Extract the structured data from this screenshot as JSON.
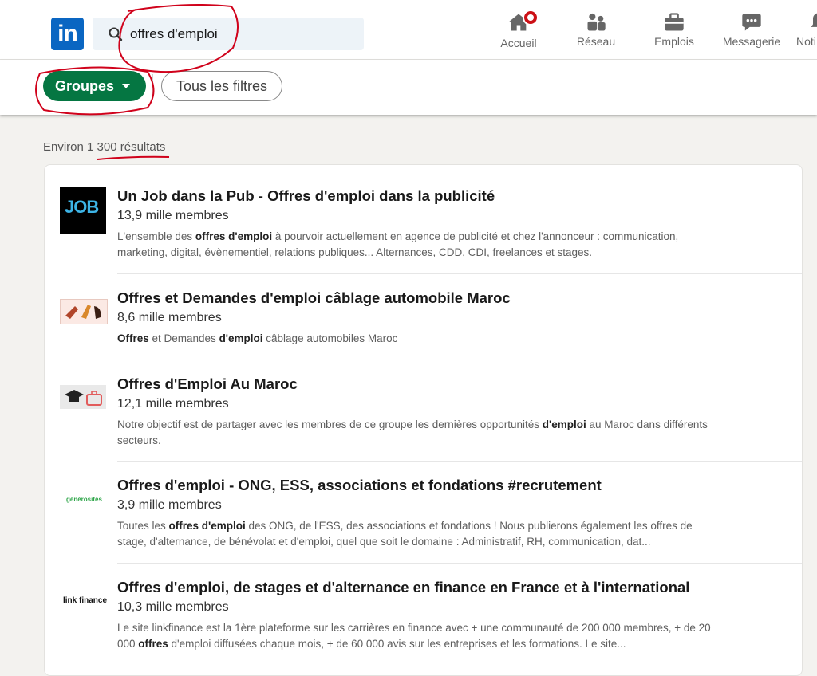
{
  "nav": {
    "logo_text": "in",
    "search_value": "offres d'emploi",
    "items": [
      {
        "label": "Accueil",
        "icon": "home-icon"
      },
      {
        "label": "Réseau",
        "icon": "network-icon"
      },
      {
        "label": "Emplois",
        "icon": "briefcase-icon"
      },
      {
        "label": "Messagerie",
        "icon": "messaging-icon"
      },
      {
        "label": "Noti",
        "icon": "bell-icon"
      }
    ]
  },
  "filters": {
    "groups_label": "Groupes",
    "all_filters_label": "Tous les filtres"
  },
  "results_count": "Environ 1 300 résultats",
  "results": [
    {
      "title": "Un Job dans la Pub - Offres d'emploi dans la publicité",
      "members": "13,9 mille membres",
      "thumb_text": "JOB",
      "desc_parts": [
        "L'ensemble des ",
        "offres d'emploi",
        " à pourvoir actuellement en agence de publicité et chez l'annonceur : communication, marketing, digital, évènementiel, relations publiques... Alternances, CDD, CDI, freelances et stages."
      ]
    },
    {
      "title": "Offres et Demandes d'emploi câblage automobile Maroc",
      "members": "8,6 mille membres",
      "desc_parts": [
        "",
        "Offres",
        " et Demandes ",
        "d'emploi",
        " câblage automobiles Maroc"
      ]
    },
    {
      "title": "Offres d'Emploi Au Maroc",
      "members": "12,1 mille membres",
      "desc_parts": [
        "Notre objectif est de partager avec les membres de ce groupe les dernières opportunités ",
        "d'emploi",
        " au Maroc dans différents secteurs."
      ]
    },
    {
      "title": "Offres d'emploi - ONG, ESS, associations et fondations #recrutement",
      "members": "3,9 mille membres",
      "thumb_text": "générosités",
      "desc_parts": [
        "Toutes les ",
        "offres d'emploi",
        " des ONG, de l'ESS, des associations et fondations ! Nous publierons également les offres de stage, d'alternance, de bénévolat et d'emploi, quel que soit le domaine : Administratif, RH, communication, dat..."
      ]
    },
    {
      "title": "Offres d'emploi, de stages et d'alternance en finance en France et à l'international",
      "members": "10,3 mille membres",
      "thumb_text": "link finance",
      "desc_parts": [
        "Le site linkfinance est la 1ère plateforme sur les carrières en finance avec + une communauté de 200 000 membres, + de 20 000 ",
        "offres",
        " d'emploi diffusées chaque mois, + de 60 000 avis sur les entreprises et les formations. Le site..."
      ]
    }
  ],
  "colors": {
    "linkedin_blue": "#0a66c2",
    "groups_green": "#057642",
    "annotation_red": "#d0021b"
  }
}
